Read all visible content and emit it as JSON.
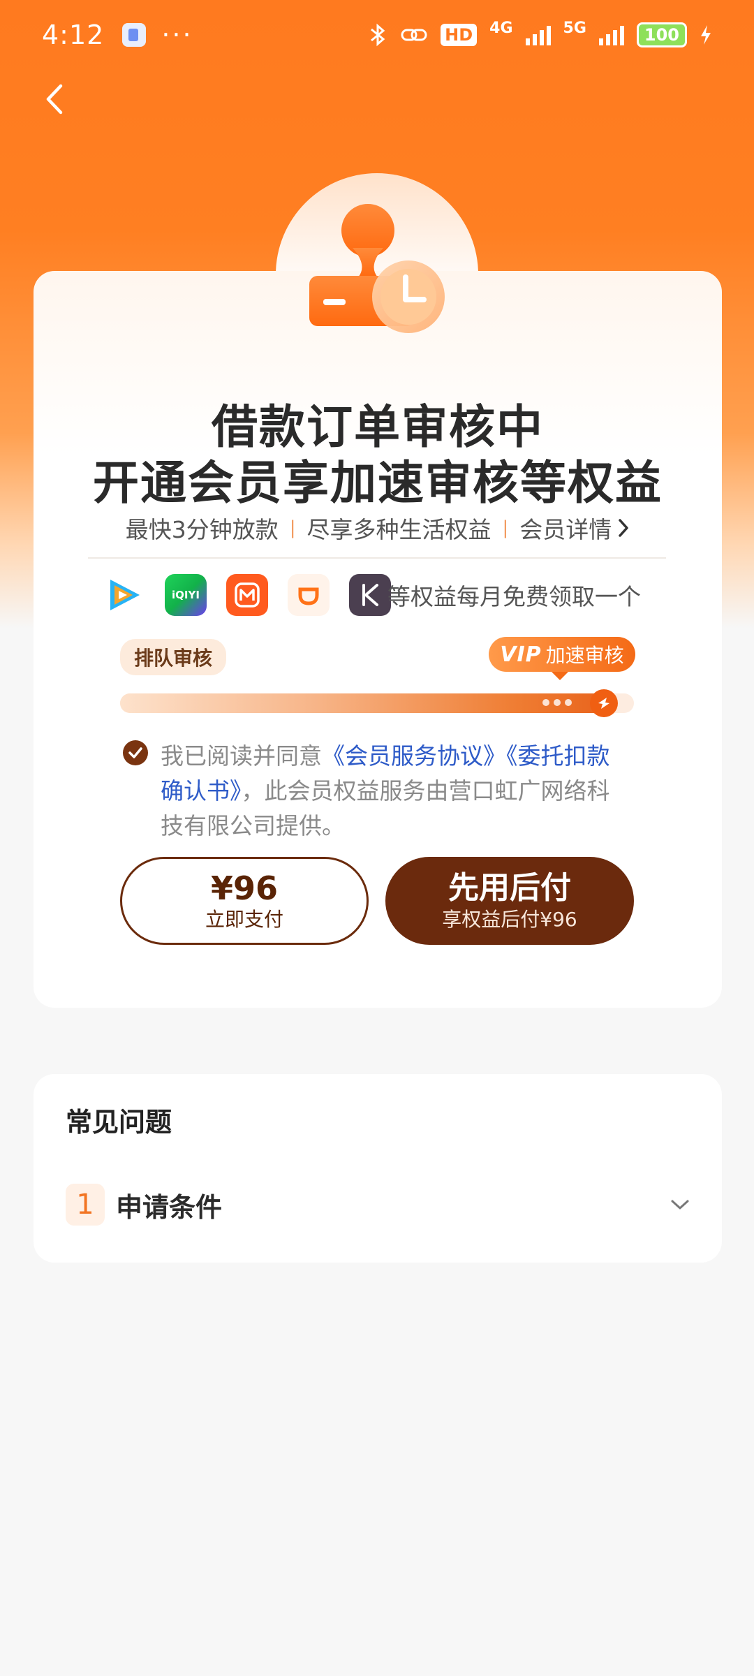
{
  "status_bar": {
    "time": "4:12",
    "dots": "···",
    "hd": "HD",
    "net_4g": "4G",
    "net_5g": "5G",
    "battery": "100"
  },
  "header": {
    "back_icon": "chevron-left-icon"
  },
  "hero": {
    "badge_icon": "stamp-clock-icon",
    "title_line1": "借款订单审核中",
    "title_line2": "开通会员享加速审核等权益",
    "subline": {
      "item1": "最快3分钟放款",
      "item2": "尽享多种生活权益",
      "item3": "会员详情"
    }
  },
  "apps": {
    "icons": [
      "tencent-video-icon",
      "iqiyi-icon",
      "mango-tv-icon",
      "didi-icon",
      "keep-icon"
    ],
    "iqiyi_text": "iQIYI",
    "text": "等权益每月免费领取一个"
  },
  "progress": {
    "queue_label": "排队审核",
    "vip_word": "VIP",
    "vip_label": "加速审核",
    "level": 0.96
  },
  "agreement": {
    "prefix": "我已阅读并同意",
    "link1": "《会员服务协议》",
    "link2": "《委托扣款确认书》",
    "suffix": "，此会员权益服务由营口虹广网络科技有限公司提供。",
    "checked": true
  },
  "buttons": {
    "pay_now_price": "¥96",
    "pay_now_label": "立即支付",
    "pay_later_label": "先用后付",
    "pay_later_sub": "享权益后付¥96"
  },
  "faq": {
    "title": "常见问题",
    "items": [
      {
        "num": "1",
        "label": "申请条件"
      }
    ]
  },
  "colors": {
    "brand_orange": "#ff7a1f",
    "button_brown": "#6b2a0d",
    "link_blue": "#2e5bc8"
  }
}
